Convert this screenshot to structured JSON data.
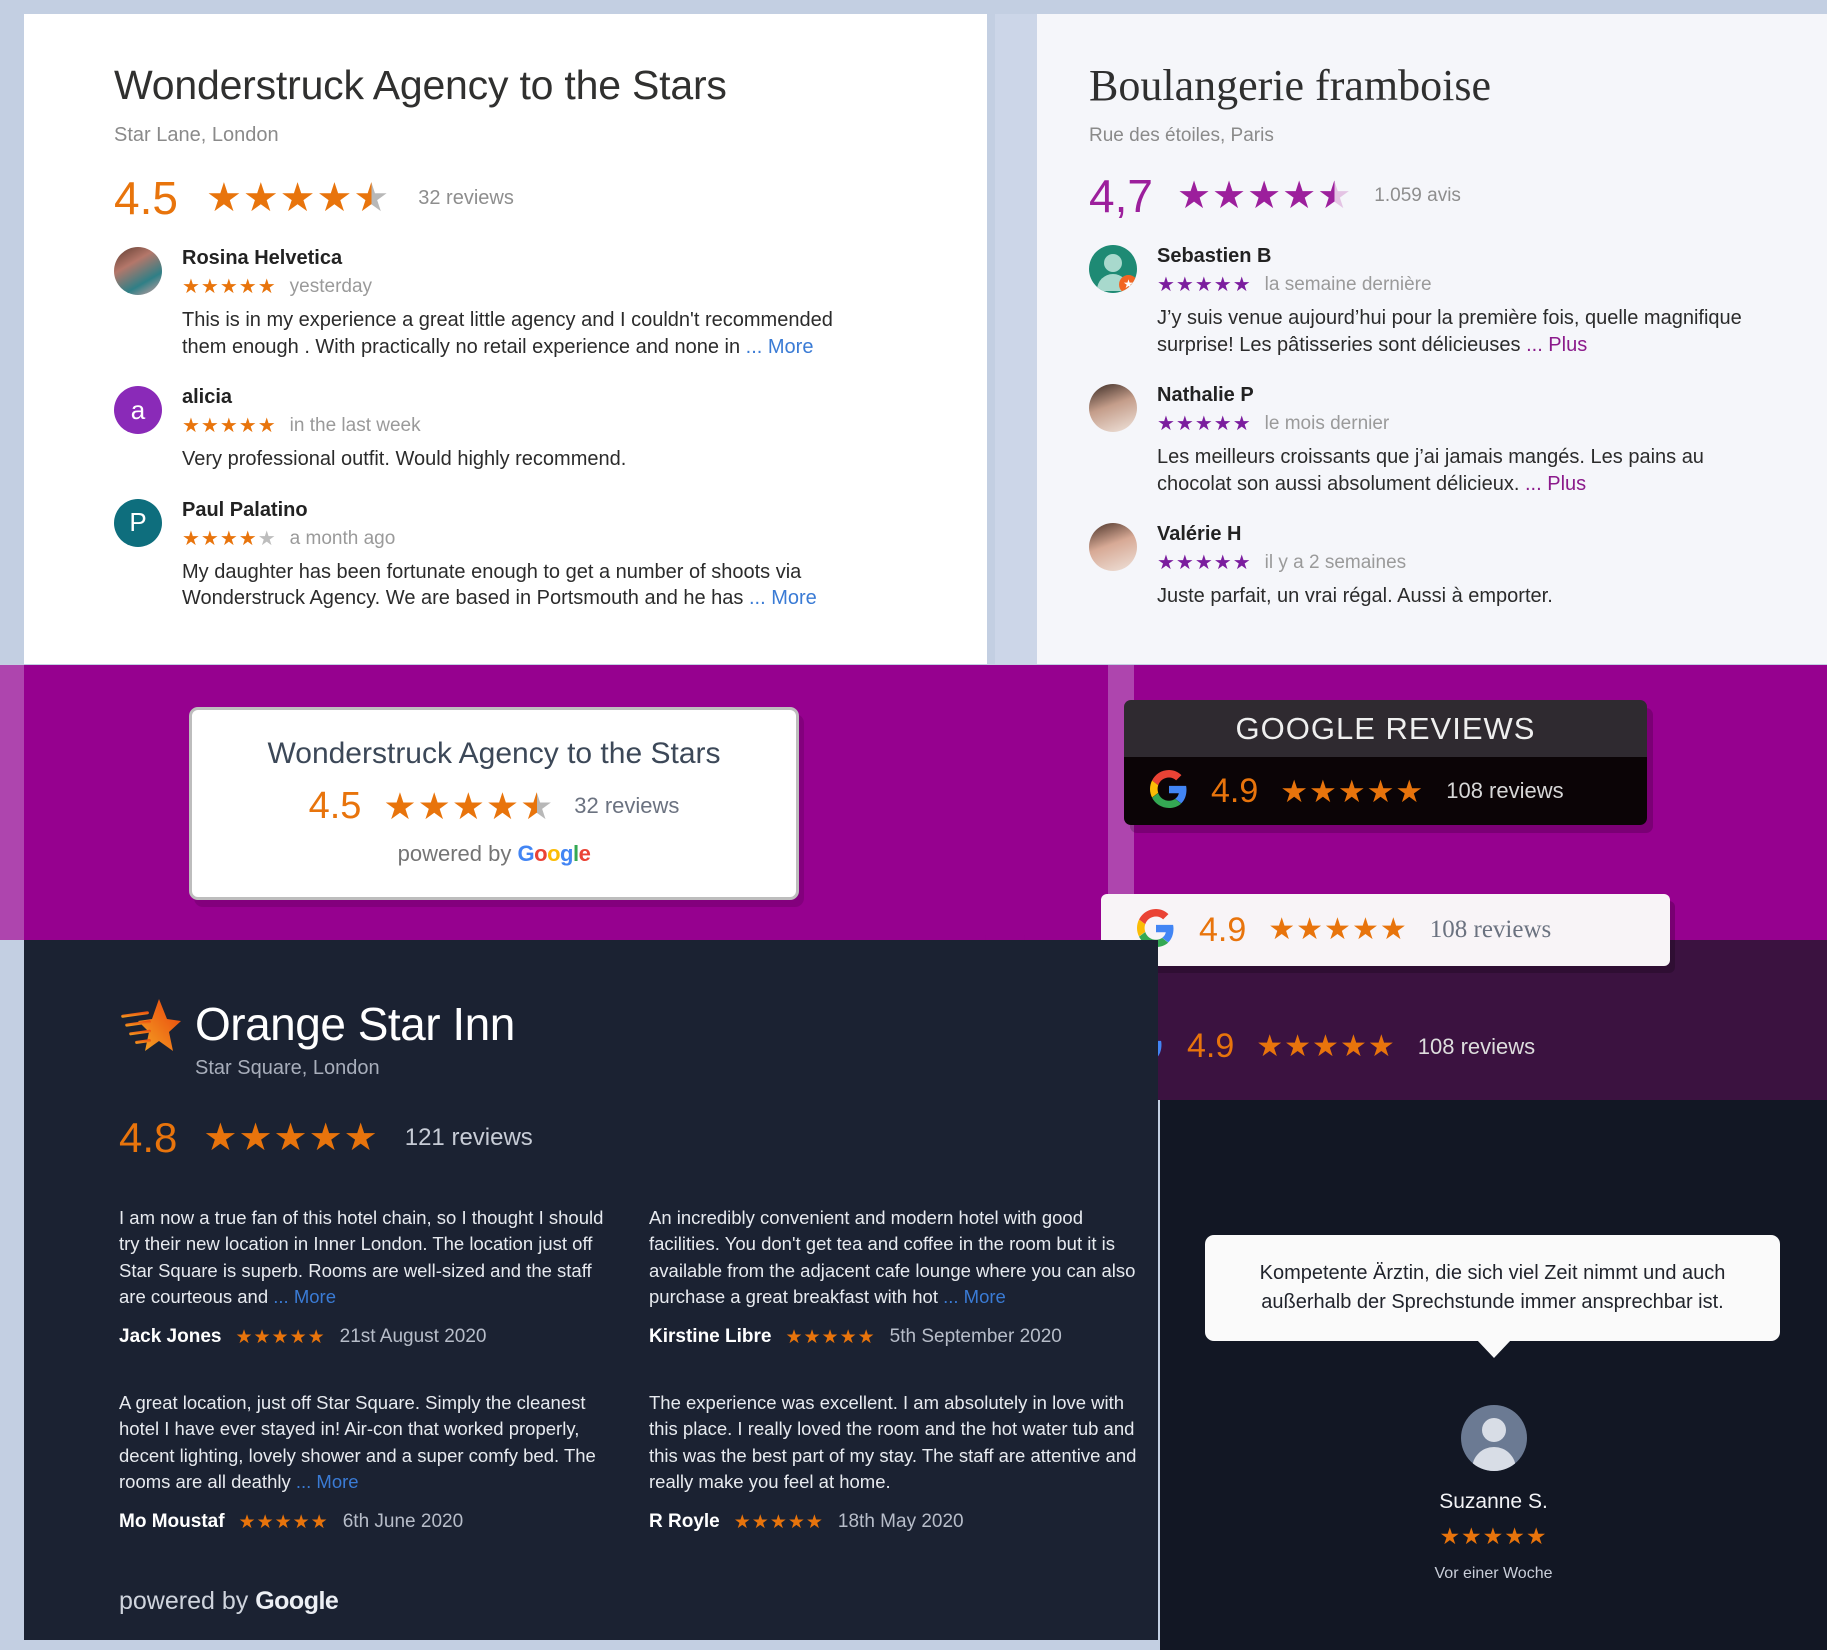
{
  "panel_wonderstruck": {
    "title": "Wonderstruck Agency to the Stars",
    "address": "Star Lane, London",
    "score": "4.5",
    "stars": "★★★★",
    "half_star": "★",
    "review_count": "32 reviews",
    "reviews": [
      {
        "avatar_kind": "photo",
        "avatar_initial": "",
        "name": "Rosina Helvetica",
        "stars": "★★★★★",
        "when": "yesterday",
        "text": "This is in my experience a great little agency and I couldn't recommended them enough . With practically no retail experience and none in",
        "more": "... More"
      },
      {
        "avatar_kind": "initial",
        "avatar_initial": "a",
        "name": "alicia",
        "stars": "★★★★★",
        "when": "in the last week",
        "text": "Very professional outfit. Would highly recommend.",
        "more": ""
      },
      {
        "avatar_kind": "initial",
        "avatar_initial": "P",
        "name": "Paul Palatino",
        "stars": "★★★★",
        "stars_empty": "★",
        "when": "a month ago",
        "text": "My daughter has been fortunate enough to get a number of shoots via Wonderstruck Agency. We are based in Portsmouth and he has",
        "more": "... More"
      }
    ]
  },
  "panel_boulangerie": {
    "title": "Boulangerie framboise",
    "address": "Rue des étoiles, Paris",
    "score": "4,7",
    "stars": "★★★★",
    "half_star": "★",
    "review_count": "1.059 avis",
    "reviews": [
      {
        "avatar_kind": "silhouette",
        "name": "Sebastien B",
        "stars": "★★★★★",
        "when": "la semaine dernière",
        "text": "J’y suis venue aujourd’hui pour la première fois, quelle magnifique surprise! Les pâtisseries sont délicieuses",
        "more": "... Plus"
      },
      {
        "avatar_kind": "photo",
        "name": "Nathalie P",
        "stars": "★★★★★",
        "when": "le mois dernier",
        "text": "Les meilleurs croissants que j’ai jamais mangés. Les pains au chocolat son aussi absolument délicieux.",
        "more": "... Plus"
      },
      {
        "avatar_kind": "photo",
        "name": "Valérie H",
        "stars": "★★★★★",
        "when": "il y a 2 semaines",
        "text": "Juste parfait, un vrai régal. Aussi à emporter.",
        "more": ""
      }
    ]
  },
  "badge_white": {
    "title": "Wonderstruck Agency to the Stars",
    "score": "4.5",
    "stars": "★★★★",
    "half_star": "★",
    "review_count": "32 reviews",
    "powered_by": "powered by",
    "google": "Google"
  },
  "badge_dark": {
    "heading": "GOOGLE REVIEWS",
    "score": "4.9",
    "stars": "★★★★★",
    "review_count": "108 reviews"
  },
  "badge_light": {
    "score": "4.9",
    "stars": "★★★★★",
    "review_count": "108 reviews"
  },
  "badge_plain": {
    "score": "4.9",
    "stars": "★★★★★",
    "review_count": "108 reviews"
  },
  "panel_hotel": {
    "title": "Orange Star Inn",
    "address": "Star Square, London",
    "score": "4.8",
    "stars": "★★★★★",
    "review_count": "121 reviews",
    "powered_by": "powered by",
    "google": "Google",
    "reviews": [
      {
        "text": "I am now a true fan of this hotel chain, so I thought I should try their new location in Inner London. The location just off Star Square is superb. Rooms are well-sized and the staff are courteous and",
        "more": "... More",
        "name": "Jack Jones",
        "stars": "★★★★★",
        "date": "21st August 2020"
      },
      {
        "text": "An incredibly convenient and modern hotel with good facilities. You don't get tea and coffee in the room but it is available from the adjacent cafe lounge where you can also purchase a great breakfast with hot",
        "more": "... More",
        "name": "Kirstine Libre",
        "stars": "★★★★★",
        "date": "5th September 2020"
      },
      {
        "text": "A great location, just off Star Square. Simply the cleanest hotel I have ever stayed in! Air-con that worked properly, decent lighting, lovely shower and a super comfy bed. The rooms are all deathly",
        "more": "... More",
        "name": "Mo Moustaf",
        "stars": "★★★★★",
        "date": "6th June 2020"
      },
      {
        "text": "The experience was excellent. I am absolutely in love with this place. I really loved the room and the hot water tub and this was the best part of my stay. The staff are attentive and really make you feel at home.",
        "more": "",
        "name": "R Royle",
        "stars": "★★★★★",
        "date": "18th May 2020"
      }
    ]
  },
  "panel_german": {
    "quote": "Kompetente Ärztin, die sich viel Zeit nimmt und auch außerhalb der Sprechstunde immer ansprechbar ist.",
    "name": "Suzanne S.",
    "stars": "★★★★★",
    "when": "Vor einer Woche"
  },
  "colors": {
    "orange": "#e8740c",
    "purple": "#96018f",
    "purple_light": "#ae45ae",
    "navy": "#1b2232",
    "dark_purple": "#3b1240"
  }
}
